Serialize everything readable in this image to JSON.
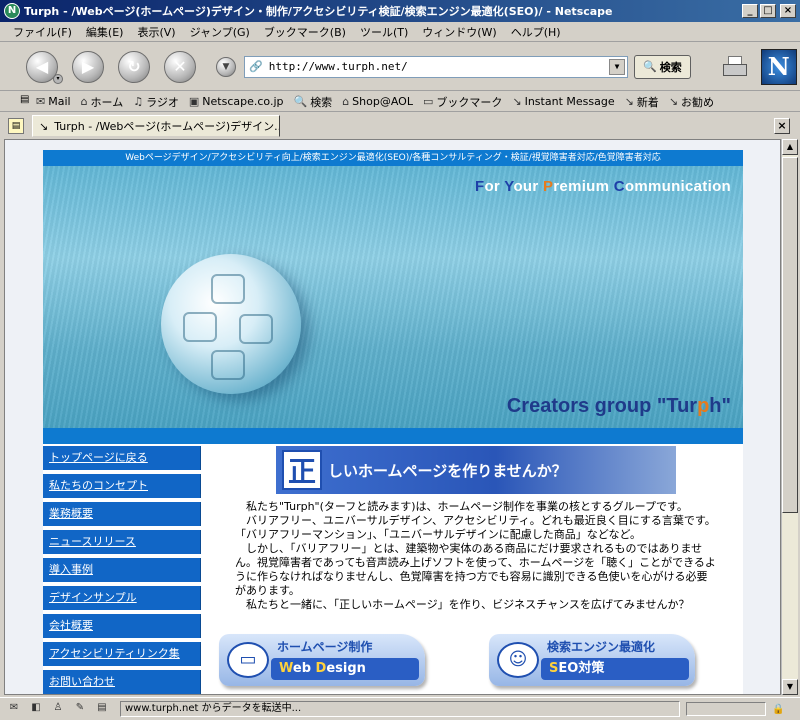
{
  "window": {
    "title": "Turph - /Webページ(ホームページ)デザイン・制作/アクセシビリティ検証/検索エンジン最適化(SEO)/ - Netscape",
    "app_icon_glyph": "N",
    "minimize_glyph": "_",
    "maximize_glyph": "□",
    "close_glyph": "×"
  },
  "menu": {
    "items": [
      "ファイル(F)",
      "編集(E)",
      "表示(V)",
      "ジャンプ(G)",
      "ブックマーク(B)",
      "ツール(T)",
      "ウィンドウ(W)",
      "ヘルプ(H)"
    ]
  },
  "navbar": {
    "url": "http://www.turph.net/",
    "search_label": "検索",
    "logo_letter": "N"
  },
  "personal_toolbar": {
    "items": [
      {
        "icon": "mail-icon",
        "label": "Mail"
      },
      {
        "icon": "home-icon",
        "label": "ホーム"
      },
      {
        "icon": "radio-icon",
        "label": "ラジオ"
      },
      {
        "icon": "my-icon",
        "label": "Netscape.co.jp"
      },
      {
        "icon": "search-icon",
        "label": "検索"
      },
      {
        "icon": "shop-icon",
        "label": "Shop@AOL"
      },
      {
        "icon": "folder-icon",
        "label": "ブックマーク"
      },
      {
        "icon": "link-icon",
        "label": "Instant Message"
      },
      {
        "icon": "link-icon",
        "label": "新着"
      },
      {
        "icon": "link-icon",
        "label": "お勧め"
      }
    ]
  },
  "tab": {
    "label": "Turph - /Webページ(ホームページ)デザイン..."
  },
  "page": {
    "tagline": "Webページデザイン/アクセシビリティ向上/検索エンジン最適化(SEO)/各種コンサルティング・検証/視覚障害者対応/色覚障害者対応",
    "hero_slogan_parts": [
      "F",
      "or ",
      "Y",
      "our ",
      "P",
      "remium ",
      "C",
      "ommunication"
    ],
    "creators_prefix": "Creators group \"Tur",
    "creators_highlight": "p",
    "creators_suffix": "h\"",
    "nav_links": [
      "トップページに戻る",
      "私たちのコンセプト",
      "業務概要",
      "ニュースリリース",
      "導入事例",
      "デザインサンプル",
      "会社概要",
      "アクセシビリティリンク集",
      "お問い合わせ"
    ],
    "banner_kanji": "正",
    "banner_text": "しいホームページを作りませんか？",
    "intro_paragraphs": [
      "私たち\"Turph\"(ターフと読みます)は、ホームページ制作を事業の核とするグループです。",
      "バリアフリー、ユニバーサルデザイン、アクセシビリティ。どれも最近良く目にする言葉です。「バリアフリーマンション」、「ユニバーサルデザインに配慮した商品」などなど。",
      "しかし、「バリアフリー」とは、建築物や実体のある商品にだけ要求されるものではありません。視覚障害者であっても音声読み上げソフトを使って、ホームページを「聴く」ことができるように作らなければなりませんし、色覚障害を持つ方でも容易に識別できる色使いを心がける必要があります。",
      "私たちと一緒に、「正しいホームページ」を作り、ビジネスチャンスを広げてみませんか？"
    ],
    "services": [
      {
        "jp": "ホームページ制作",
        "en_accent": "W",
        "en_mid": "eb ",
        "en_accent2": "D",
        "en_rest": "esign"
      },
      {
        "jp": "検索エンジン最適化",
        "en_accent": "S",
        "en_mid": "EO",
        "en_accent2": "",
        "en_rest": "対策"
      }
    ]
  },
  "status": {
    "text": "www.turph.net からデータを転送中..."
  },
  "colors": {
    "title_bar": "#0a246a",
    "brand_blue": "#0e7ad0",
    "nav_blue": "#1166c6",
    "accent_orange": "#e57b1e"
  }
}
